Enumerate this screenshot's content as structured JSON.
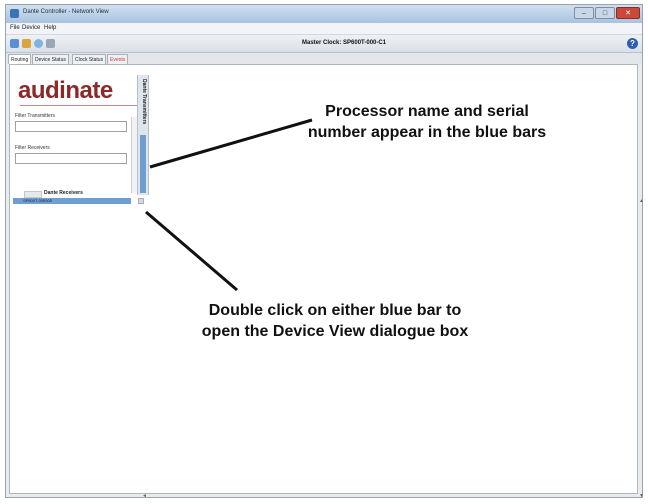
{
  "window": {
    "title": "Dante Controller - Network View"
  },
  "menubar": {
    "items": [
      "File",
      "Device",
      "Help"
    ]
  },
  "toolbar": {
    "master_clock": "Master Clock: SP600T-000-C1"
  },
  "tabs": [
    {
      "label": "Routing"
    },
    {
      "label": "Device Status"
    },
    {
      "label": "Clock Status"
    },
    {
      "label": "Events"
    }
  ],
  "sidebar": {
    "logo": "audinate",
    "filter_transmitters_label": "Filter Transmitters",
    "filter_receivers_label": "Filter Receivers",
    "transmitters_header": "Dante Transmitters",
    "receivers_header": "Dante Receivers",
    "receiver_device": "SP600T-000000"
  },
  "annotations": {
    "processor_note": "Processor name and serial number appear in the blue bars",
    "double_click_note": "Double click on either blue bar to open the Device View dialogue box"
  },
  "colors": {
    "blue_bar": "#6f9fd1",
    "logo": "#8c2a2a"
  }
}
